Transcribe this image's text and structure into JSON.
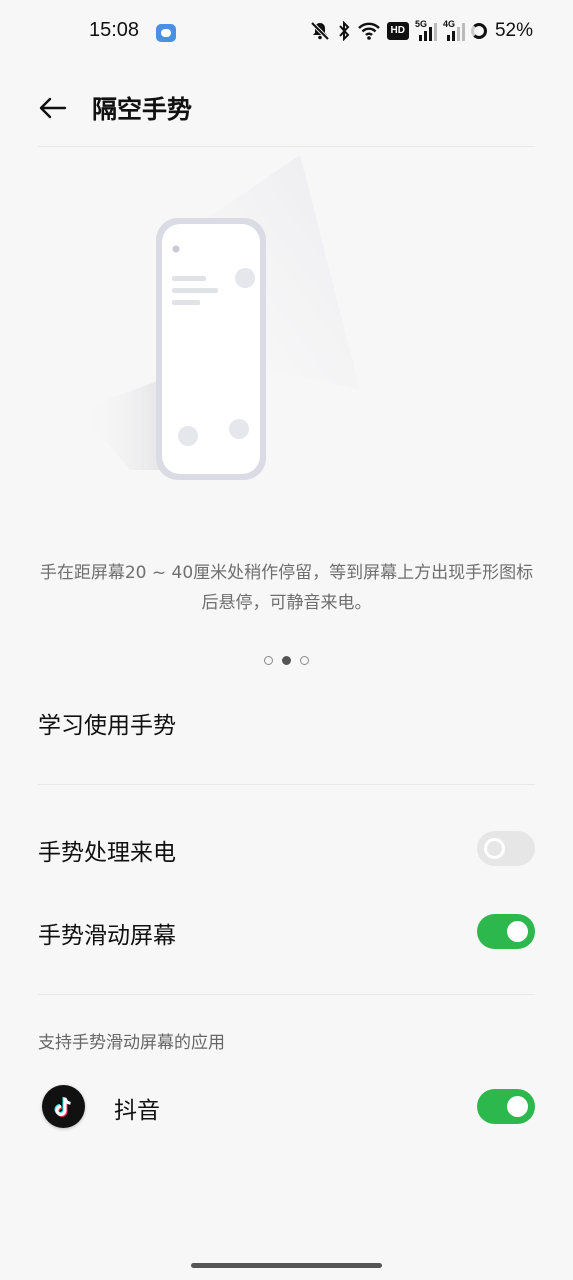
{
  "status_bar": {
    "time": "15:08",
    "hd_label": "HD",
    "sim1_tag": "5G",
    "sim2_tag": "4G",
    "battery": "52%"
  },
  "header": {
    "title": "隔空手势"
  },
  "tutorial": {
    "description": "手在距屏幕20 ~ 40厘米处稍作停留，等到屏幕上方出现手形图标后悬停，可静音来电。",
    "page_count": 3,
    "current_page": 2
  },
  "settings": {
    "learn_label": "学习使用手势",
    "calls_label": "手势处理来电",
    "calls_enabled": false,
    "scroll_label": "手势滑动屏幕",
    "scroll_enabled": true,
    "apps_section_label": "支持手势滑动屏幕的应用",
    "apps": [
      {
        "name": "抖音",
        "icon": "tiktok-icon",
        "enabled": true
      }
    ]
  },
  "colors": {
    "toggle_on": "#2db84d",
    "toggle_off": "#e6e6e6",
    "background": "#f7f7f7"
  }
}
